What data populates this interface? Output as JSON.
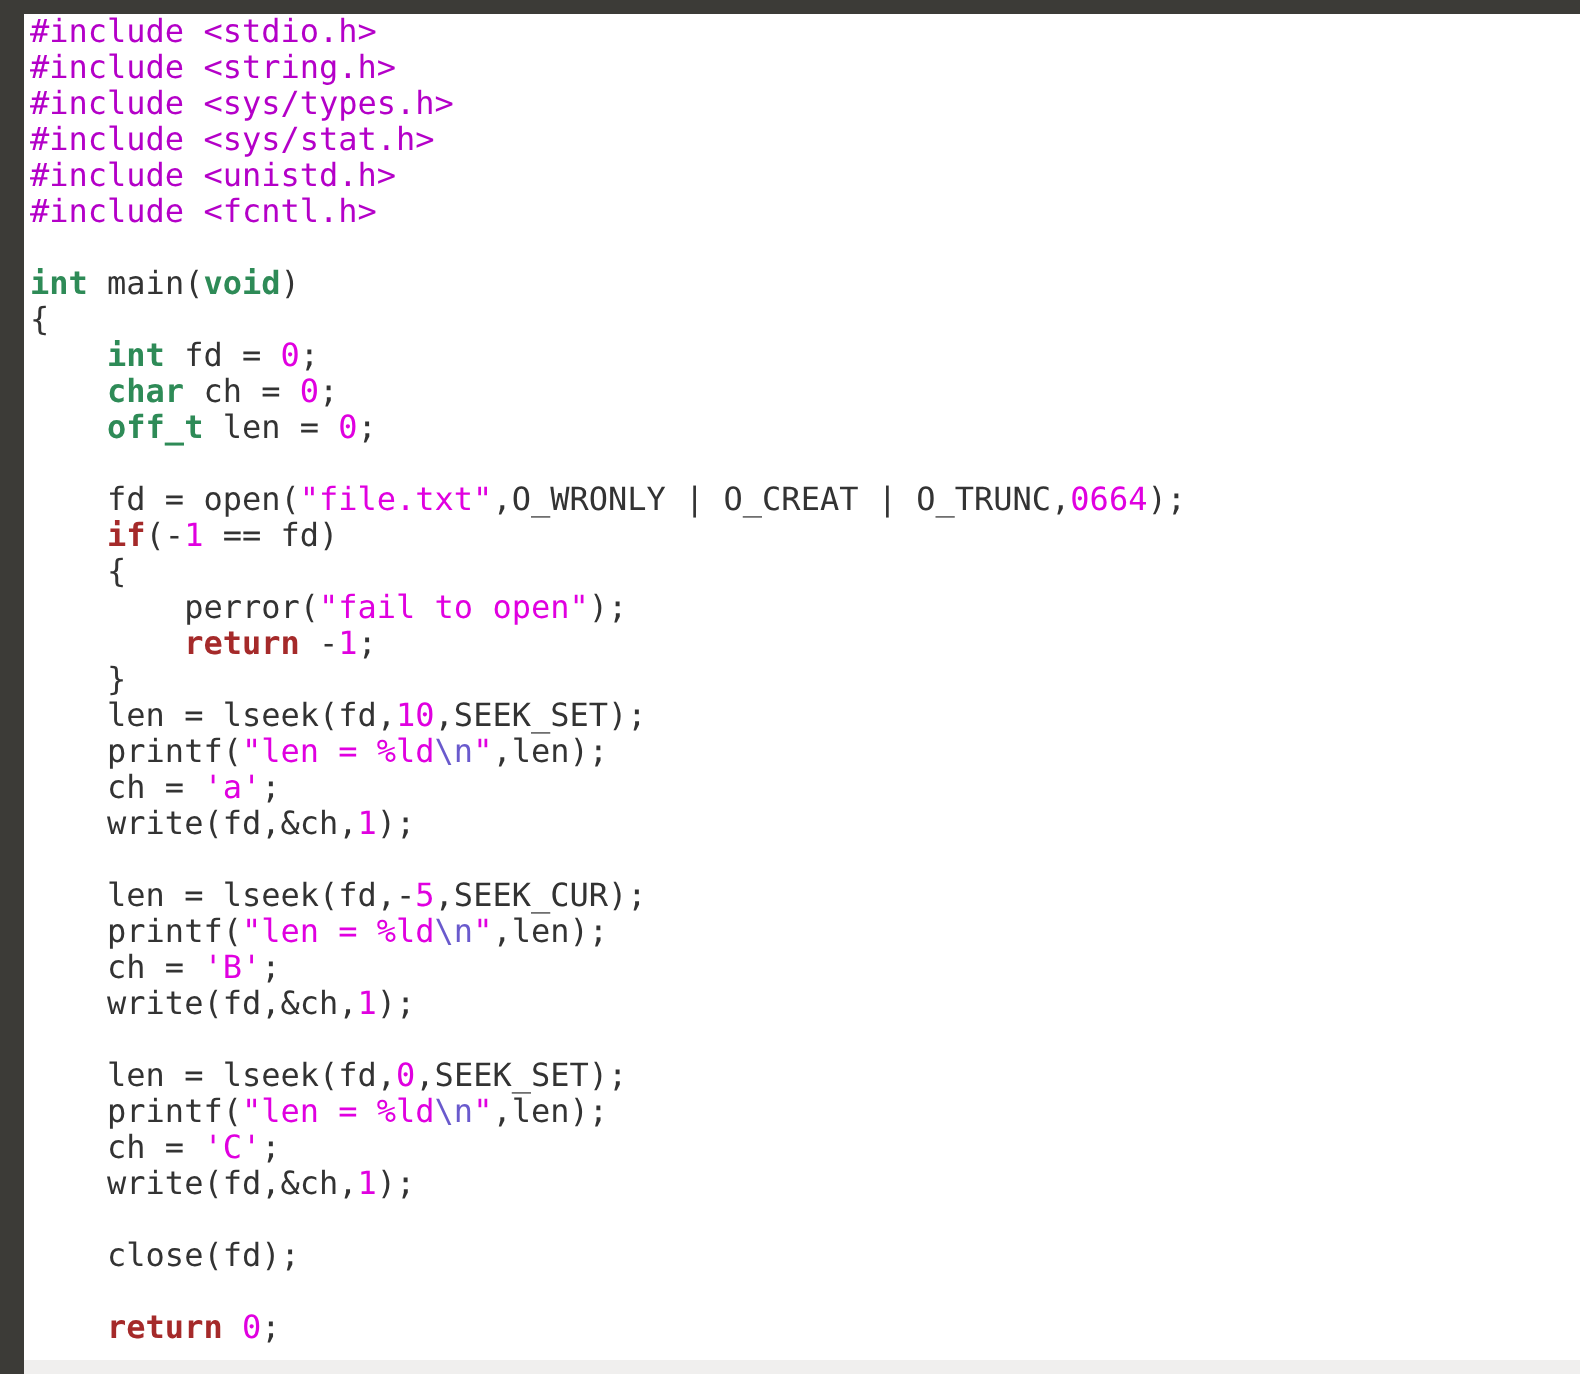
{
  "editor": {
    "lines": [
      {
        "tokens": [
          {
            "kind": "pp",
            "text": "#include <stdio.h>"
          }
        ]
      },
      {
        "tokens": [
          {
            "kind": "pp",
            "text": "#include <string.h>"
          }
        ]
      },
      {
        "tokens": [
          {
            "kind": "pp",
            "text": "#include <sys/types.h>"
          }
        ]
      },
      {
        "tokens": [
          {
            "kind": "pp",
            "text": "#include <sys/stat.h>"
          }
        ]
      },
      {
        "tokens": [
          {
            "kind": "pp",
            "text": "#include <unistd.h>"
          }
        ]
      },
      {
        "tokens": [
          {
            "kind": "pp",
            "text": "#include <fcntl.h>"
          }
        ]
      },
      {
        "kind": "blank"
      },
      {
        "tokens": [
          {
            "kind": "type",
            "text": "int"
          },
          {
            "kind": "plain",
            "text": " main("
          },
          {
            "kind": "type",
            "text": "void"
          },
          {
            "kind": "plain",
            "text": ")"
          }
        ]
      },
      {
        "tokens": [
          {
            "kind": "plain",
            "text": "{"
          }
        ]
      },
      {
        "tokens": [
          {
            "kind": "type",
            "text": "    int"
          },
          {
            "kind": "plain",
            "text": " fd = "
          },
          {
            "kind": "num",
            "text": "0"
          },
          {
            "kind": "plain",
            "text": ";"
          }
        ]
      },
      {
        "tokens": [
          {
            "kind": "type",
            "text": "    char"
          },
          {
            "kind": "plain",
            "text": " ch = "
          },
          {
            "kind": "num",
            "text": "0"
          },
          {
            "kind": "plain",
            "text": ";"
          }
        ]
      },
      {
        "tokens": [
          {
            "kind": "type",
            "text": "    off_t"
          },
          {
            "kind": "plain",
            "text": " len = "
          },
          {
            "kind": "num",
            "text": "0"
          },
          {
            "kind": "plain",
            "text": ";"
          }
        ]
      },
      {
        "kind": "blank"
      },
      {
        "tokens": [
          {
            "kind": "plain",
            "text": "    fd = open("
          },
          {
            "kind": "str",
            "text": "\"file.txt\""
          },
          {
            "kind": "plain",
            "text": ",O_WRONLY | O_CREAT | O_TRUNC,"
          },
          {
            "kind": "num",
            "text": "0664"
          },
          {
            "kind": "plain",
            "text": ");"
          }
        ]
      },
      {
        "tokens": [
          {
            "kind": "kw",
            "text": "    if"
          },
          {
            "kind": "plain",
            "text": "(-"
          },
          {
            "kind": "num",
            "text": "1"
          },
          {
            "kind": "plain",
            "text": " == fd)"
          }
        ]
      },
      {
        "tokens": [
          {
            "kind": "plain",
            "text": "    {"
          }
        ]
      },
      {
        "tokens": [
          {
            "kind": "plain",
            "text": "        perror("
          },
          {
            "kind": "str",
            "text": "\"fail to open\""
          },
          {
            "kind": "plain",
            "text": ");"
          }
        ]
      },
      {
        "tokens": [
          {
            "kind": "kw",
            "text": "        return"
          },
          {
            "kind": "plain",
            "text": " -"
          },
          {
            "kind": "num",
            "text": "1"
          },
          {
            "kind": "plain",
            "text": ";"
          }
        ]
      },
      {
        "tokens": [
          {
            "kind": "plain",
            "text": "    }"
          }
        ]
      },
      {
        "tokens": [
          {
            "kind": "plain",
            "text": "    len = lseek(fd,"
          },
          {
            "kind": "num",
            "text": "10"
          },
          {
            "kind": "plain",
            "text": ",SEEK_SET);"
          }
        ]
      },
      {
        "tokens": [
          {
            "kind": "plain",
            "text": "    printf("
          },
          {
            "kind": "str",
            "text": "\"len = %ld"
          },
          {
            "kind": "special",
            "text": "\\n"
          },
          {
            "kind": "str",
            "text": "\""
          },
          {
            "kind": "plain",
            "text": ",len);"
          }
        ]
      },
      {
        "tokens": [
          {
            "kind": "plain",
            "text": "    ch = "
          },
          {
            "kind": "str",
            "text": "'a'"
          },
          {
            "kind": "plain",
            "text": ";"
          }
        ]
      },
      {
        "tokens": [
          {
            "kind": "plain",
            "text": "    write(fd,&ch,"
          },
          {
            "kind": "num",
            "text": "1"
          },
          {
            "kind": "plain",
            "text": ");"
          }
        ]
      },
      {
        "kind": "blank"
      },
      {
        "tokens": [
          {
            "kind": "plain",
            "text": "    len = lseek(fd,-"
          },
          {
            "kind": "num",
            "text": "5"
          },
          {
            "kind": "plain",
            "text": ",SEEK_CUR);"
          }
        ]
      },
      {
        "tokens": [
          {
            "kind": "plain",
            "text": "    printf("
          },
          {
            "kind": "str",
            "text": "\"len = %ld"
          },
          {
            "kind": "special",
            "text": "\\n"
          },
          {
            "kind": "str",
            "text": "\""
          },
          {
            "kind": "plain",
            "text": ",len);"
          }
        ]
      },
      {
        "tokens": [
          {
            "kind": "plain",
            "text": "    ch = "
          },
          {
            "kind": "str",
            "text": "'B'"
          },
          {
            "kind": "plain",
            "text": ";"
          }
        ]
      },
      {
        "tokens": [
          {
            "kind": "plain",
            "text": "    write(fd,&ch,"
          },
          {
            "kind": "num",
            "text": "1"
          },
          {
            "kind": "plain",
            "text": ");"
          }
        ]
      },
      {
        "kind": "blank"
      },
      {
        "tokens": [
          {
            "kind": "plain",
            "text": "    len = lseek(fd,"
          },
          {
            "kind": "num",
            "text": "0"
          },
          {
            "kind": "plain",
            "text": ",SEEK_SET);"
          }
        ]
      },
      {
        "tokens": [
          {
            "kind": "plain",
            "text": "    printf("
          },
          {
            "kind": "str",
            "text": "\"len = %ld"
          },
          {
            "kind": "special",
            "text": "\\n"
          },
          {
            "kind": "str",
            "text": "\""
          },
          {
            "kind": "plain",
            "text": ",len);"
          }
        ]
      },
      {
        "tokens": [
          {
            "kind": "plain",
            "text": "    ch = "
          },
          {
            "kind": "str",
            "text": "'C'"
          },
          {
            "kind": "plain",
            "text": ";"
          }
        ]
      },
      {
        "tokens": [
          {
            "kind": "plain",
            "text": "    write(fd,&ch,"
          },
          {
            "kind": "num",
            "text": "1"
          },
          {
            "kind": "plain",
            "text": ");"
          }
        ]
      },
      {
        "kind": "blank"
      },
      {
        "tokens": [
          {
            "kind": "plain",
            "text": "    close(fd);"
          }
        ]
      },
      {
        "kind": "blank"
      },
      {
        "tokens": [
          {
            "kind": "kw",
            "text": "    return "
          },
          {
            "kind": "num",
            "text": "0"
          },
          {
            "kind": "plain",
            "text": ";"
          }
        ]
      }
    ]
  }
}
